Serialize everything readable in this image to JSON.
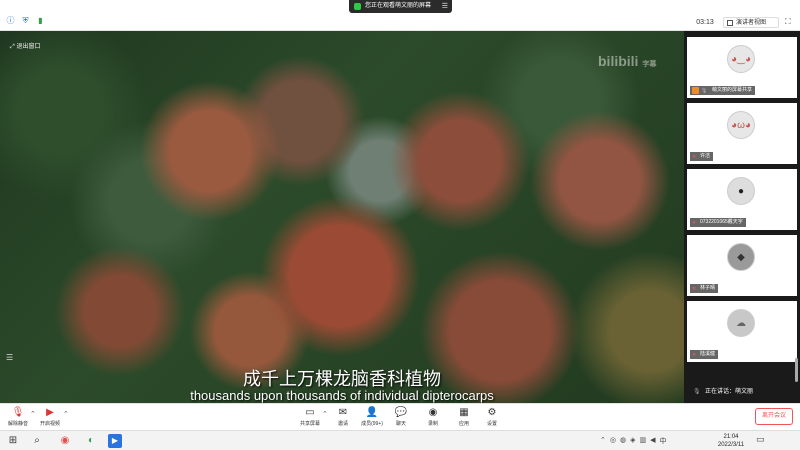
{
  "topbar": {
    "share_banner": "您正在观看萌文丽的屏幕",
    "timer": "03:13",
    "view_label": "演讲者视图"
  },
  "video": {
    "label": "退出窗口",
    "watermark_main": "bilibili",
    "watermark_side": "字幕",
    "subtitle_cn": "成千上万棵龙脑香科植物",
    "subtitle_en": "thousands upon thousands of individual dipterocarps"
  },
  "participants": [
    {
      "name": "萌文丽的屏幕共享",
      "avatar": "",
      "sharing": true,
      "muted": false
    },
    {
      "name": "许洁",
      "avatar": "",
      "sharing": false,
      "muted": true
    },
    {
      "name": "0732201065戴天宇",
      "avatar": "",
      "sharing": false,
      "muted": true
    },
    {
      "name": "林子晴",
      "avatar": "",
      "sharing": false,
      "muted": true
    },
    {
      "name": "陆溪健",
      "avatar": "",
      "sharing": false,
      "muted": true
    }
  ],
  "active_speaker": "正在讲话：萌文丽",
  "toolbar": {
    "unmute": "解除静音",
    "start_video": "开启视频",
    "share_screen": "共享屏幕",
    "invite": "邀请",
    "members": "成员(99+)",
    "chat": "聊天",
    "record": "录制",
    "apps": "应用",
    "settings": "设置",
    "leave": "离开会议"
  },
  "taskbar": {
    "time": "21:04",
    "date": "2022/3/11",
    "ime": "中"
  }
}
